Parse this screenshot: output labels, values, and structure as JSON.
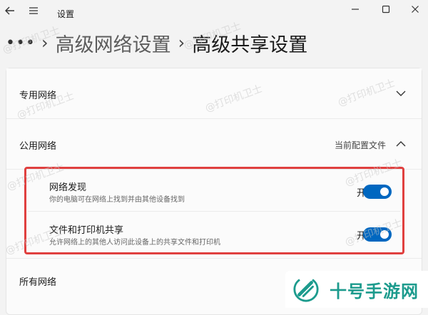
{
  "window": {
    "title": "设置"
  },
  "breadcrumb": {
    "more": "•••",
    "parent": "高级网络设置",
    "current": "高级共享设置",
    "separator": "›"
  },
  "sections": {
    "private": {
      "label": "专用网络"
    },
    "public": {
      "label": "公用网络",
      "current_profile": "当前配置文件",
      "items": [
        {
          "title": "网络发现",
          "description": "你的电脑可在网络上找到并由其他设备找到",
          "toggle_state_text": "开",
          "on": true
        },
        {
          "title": "文件和打印机共享",
          "description": "允许网络上的其他人访问此设备上的共享文件和打印机",
          "toggle_state_text": "开",
          "on": true
        }
      ]
    },
    "all": {
      "label": "所有网络"
    }
  },
  "watermark": {
    "text": "@打印机卫士"
  },
  "brand": {
    "name": "十号手游网"
  },
  "colors": {
    "accent": "#0067c0",
    "highlight": "#e0403f",
    "brand": "#1c9b8d"
  }
}
